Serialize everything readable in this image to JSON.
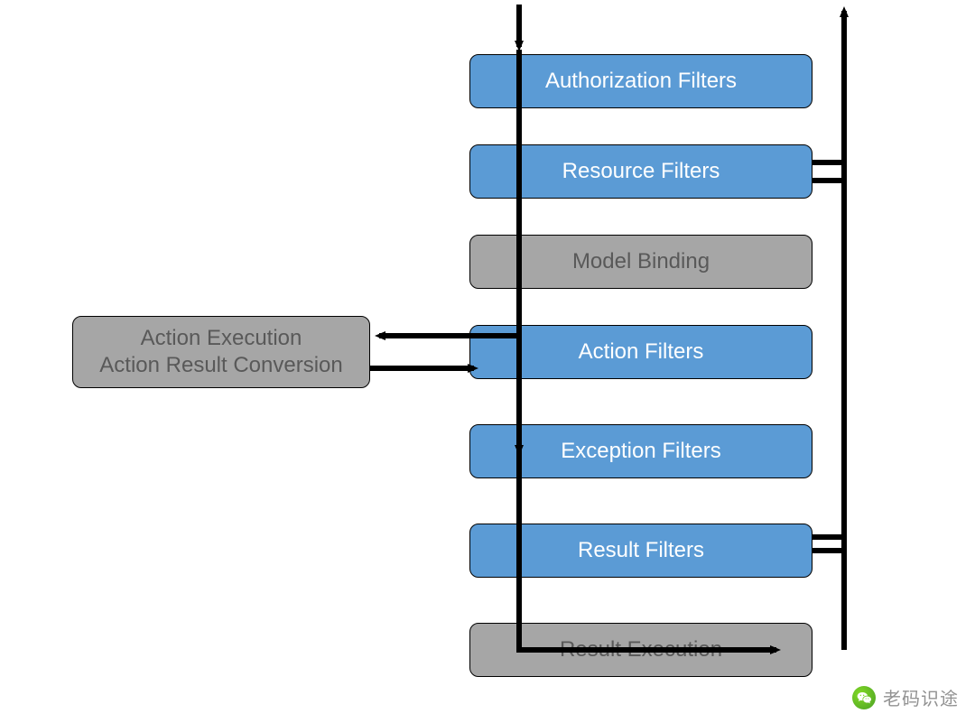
{
  "boxes": {
    "authorization": "Authorization Filters",
    "resource": "Resource Filters",
    "model_binding": "Model Binding",
    "action": "Action Filters",
    "exception": "Exception Filters",
    "result": "Result Filters",
    "result_execution": "Result Execution"
  },
  "side_box": {
    "line1": "Action Execution",
    "line2": "Action Result Conversion"
  },
  "watermark": "老码识途",
  "colors": {
    "blue": "#5b9bd5",
    "gray": "#a6a6a6",
    "arrow": "#000000"
  },
  "chart_data": {
    "type": "flowchart",
    "title": "",
    "nodes": [
      {
        "id": "entry",
        "label": "",
        "kind": "pointer"
      },
      {
        "id": "authorization",
        "label": "Authorization Filters",
        "style": "blue"
      },
      {
        "id": "resource",
        "label": "Resource Filters",
        "style": "blue"
      },
      {
        "id": "model_binding",
        "label": "Model Binding",
        "style": "gray"
      },
      {
        "id": "action",
        "label": "Action Filters",
        "style": "blue"
      },
      {
        "id": "action_execution",
        "label": "Action Execution / Action Result Conversion",
        "style": "gray-side"
      },
      {
        "id": "exception",
        "label": "Exception Filters",
        "style": "blue"
      },
      {
        "id": "result",
        "label": "Result Filters",
        "style": "blue"
      },
      {
        "id": "result_execution",
        "label": "Result Execution",
        "style": "gray"
      },
      {
        "id": "exit",
        "label": "",
        "kind": "pointer"
      }
    ],
    "edges": [
      {
        "from": "entry",
        "to": "authorization"
      },
      {
        "from": "authorization",
        "to": "resource"
      },
      {
        "from": "resource",
        "to": "model_binding"
      },
      {
        "from": "model_binding",
        "to": "action"
      },
      {
        "from": "action",
        "to": "action_execution",
        "bidirectional": true
      },
      {
        "from": "action",
        "to": "exception"
      },
      {
        "from": "exception",
        "to": "result"
      },
      {
        "from": "result",
        "to": "result_execution"
      },
      {
        "from": "result_execution",
        "to": "result",
        "return": true
      },
      {
        "from": "result",
        "to": "resource",
        "return": true
      },
      {
        "from": "resource",
        "to": "exit",
        "return": true
      }
    ]
  }
}
